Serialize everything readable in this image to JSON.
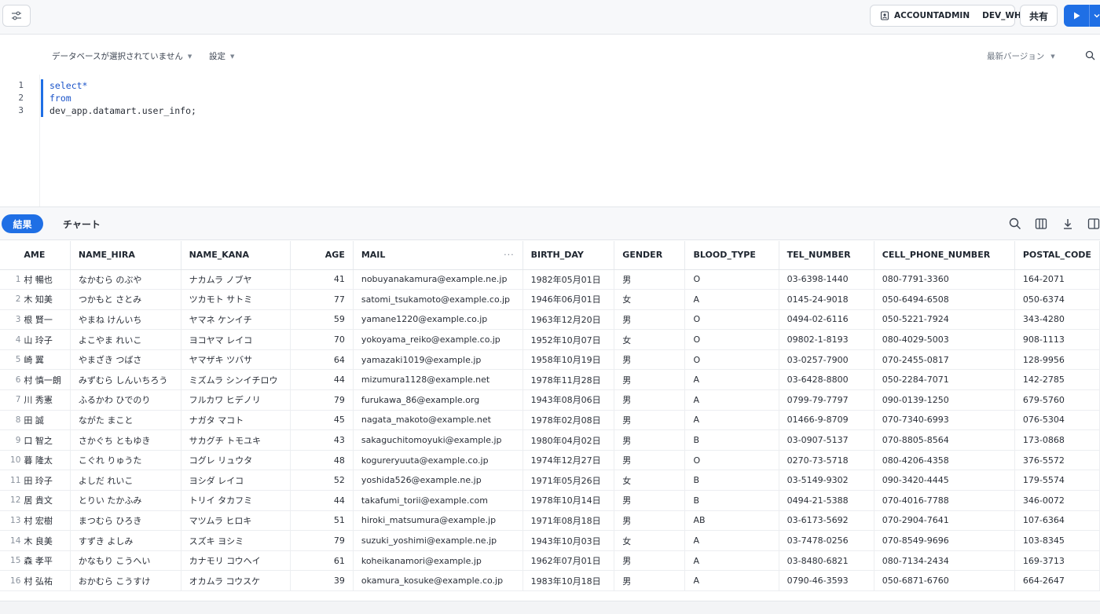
{
  "topbar": {
    "role": "ACCOUNTADMIN",
    "warehouse": "DEV_WH",
    "share_label": "共有"
  },
  "editor_header": {
    "database_placeholder": "データベースが選択されていません",
    "settings_label": "設定",
    "version_label": "最新バージョン"
  },
  "editor": {
    "lines": [
      {
        "no": "1",
        "text": "select*"
      },
      {
        "no": "2",
        "text": "from"
      },
      {
        "no": "3",
        "text": "dev_app.datamart.user_info;"
      }
    ]
  },
  "results": {
    "tab_results": "結果",
    "tab_chart": "チャート"
  },
  "table": {
    "columns": [
      "AME",
      "NAME_HIRA",
      "NAME_KANA",
      "AGE",
      "MAIL",
      "BIRTH_DAY",
      "GENDER",
      "BLOOD_TYPE",
      "TEL_NUMBER",
      "CELL_PHONE_NUMBER",
      "POSTAL_CODE"
    ],
    "mail_more": "···",
    "rows": [
      [
        "1",
        "村 暢也",
        "なかむら のぶや",
        "ナカムラ ノブヤ",
        "41",
        "nobuyanakamura@example.ne.jp",
        "1982年05月01日",
        "男",
        "O",
        "03-6398-1440",
        "080-7791-3360",
        "164-2071"
      ],
      [
        "2",
        "木 知美",
        "つかもと さとみ",
        "ツカモト サトミ",
        "77",
        "satomi_tsukamoto@example.co.jp",
        "1946年06月01日",
        "女",
        "A",
        "0145-24-9018",
        "050-6494-6508",
        "050-6374"
      ],
      [
        "3",
        "根 賢一",
        "やまね けんいち",
        "ヤマネ ケンイチ",
        "59",
        "yamane1220@example.co.jp",
        "1963年12月20日",
        "男",
        "O",
        "0494-02-6116",
        "050-5221-7924",
        "343-4280"
      ],
      [
        "4",
        "山 玲子",
        "よこやま れいこ",
        "ヨコヤマ レイコ",
        "70",
        "yokoyama_reiko@example.co.jp",
        "1952年10月07日",
        "女",
        "O",
        "09802-1-8193",
        "080-4029-5003",
        "908-1113"
      ],
      [
        "5",
        "崎 翼",
        "やまざき つばさ",
        "ヤマザキ ツバサ",
        "64",
        "yamazaki1019@example.jp",
        "1958年10月19日",
        "男",
        "O",
        "03-0257-7900",
        "070-2455-0817",
        "128-9956"
      ],
      [
        "6",
        "村 慎一朗",
        "みずむら しんいちろう",
        "ミズムラ シンイチロウ",
        "44",
        "mizumura1128@example.net",
        "1978年11月28日",
        "男",
        "A",
        "03-6428-8800",
        "050-2284-7071",
        "142-2785"
      ],
      [
        "7",
        "川 秀憲",
        "ふるかわ ひでのり",
        "フルカワ ヒデノリ",
        "79",
        "furukawa_86@example.org",
        "1943年08月06日",
        "男",
        "A",
        "0799-79-7797",
        "090-0139-1250",
        "679-5760"
      ],
      [
        "8",
        "田 誠",
        "ながた まこと",
        "ナガタ マコト",
        "45",
        "nagata_makoto@example.net",
        "1978年02月08日",
        "男",
        "A",
        "01466-9-8709",
        "070-7340-6993",
        "076-5304"
      ],
      [
        "9",
        "口 智之",
        "さかぐち ともゆき",
        "サカグチ トモユキ",
        "43",
        "sakaguchitomoyuki@example.jp",
        "1980年04月02日",
        "男",
        "B",
        "03-0907-5137",
        "070-8805-8564",
        "173-0868"
      ],
      [
        "10",
        "暮 隆太",
        "こぐれ りゅうた",
        "コグレ リュウタ",
        "48",
        "kogureryuuta@example.co.jp",
        "1974年12月27日",
        "男",
        "O",
        "0270-73-5718",
        "080-4206-4358",
        "376-5572"
      ],
      [
        "11",
        "田 玲子",
        "よしだ れいこ",
        "ヨシダ レイコ",
        "52",
        "yoshida526@example.ne.jp",
        "1971年05月26日",
        "女",
        "B",
        "03-5149-9302",
        "090-3420-4445",
        "179-5574"
      ],
      [
        "12",
        "居 貴文",
        "とりい たかふみ",
        "トリイ タカフミ",
        "44",
        "takafumi_torii@example.com",
        "1978年10月14日",
        "男",
        "B",
        "0494-21-5388",
        "070-4016-7788",
        "346-0072"
      ],
      [
        "13",
        "村 宏樹",
        "まつむら ひろき",
        "マツムラ ヒロキ",
        "51",
        "hiroki_matsumura@example.jp",
        "1971年08月18日",
        "男",
        "AB",
        "03-6173-5692",
        "070-2904-7641",
        "107-6364"
      ],
      [
        "14",
        "木 良美",
        "すずき よしみ",
        "スズキ ヨシミ",
        "79",
        "suzuki_yoshimi@example.ne.jp",
        "1943年10月03日",
        "女",
        "A",
        "03-7478-0256",
        "070-8549-9696",
        "103-8345"
      ],
      [
        "15",
        "森 孝平",
        "かなもり こうへい",
        "カナモリ コウヘイ",
        "61",
        "koheikanamori@example.jp",
        "1962年07月01日",
        "男",
        "A",
        "03-8480-6821",
        "080-7134-2434",
        "169-3713"
      ],
      [
        "16",
        "村 弘祐",
        "おかむら こうすけ",
        "オカムラ コウスケ",
        "39",
        "okamura_kosuke@example.co.jp",
        "1983年10月18日",
        "男",
        "A",
        "0790-46-3593",
        "050-6871-6760",
        "664-2647"
      ]
    ]
  }
}
